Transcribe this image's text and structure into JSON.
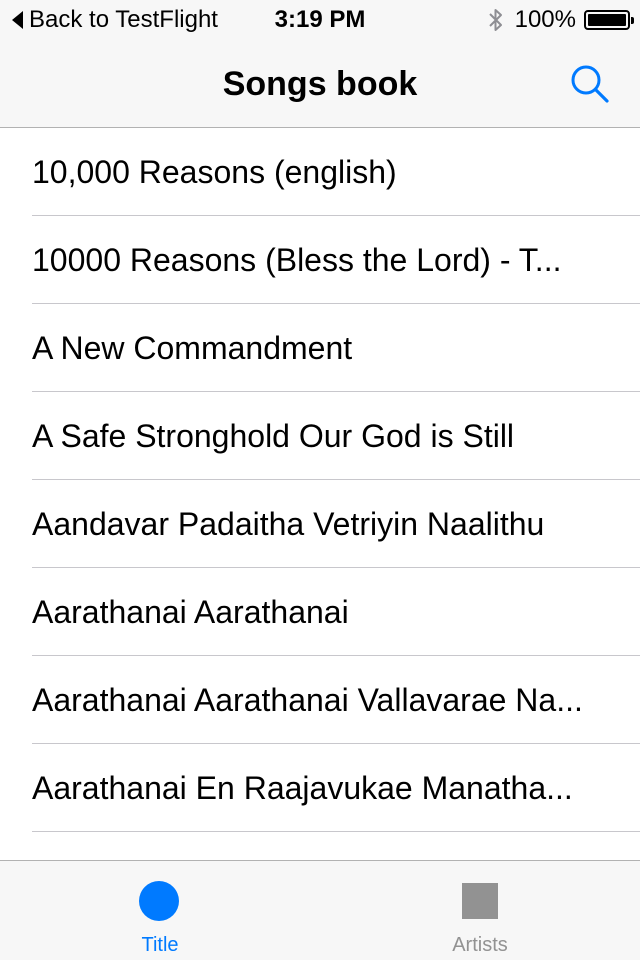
{
  "status_bar": {
    "back_label": "Back to TestFlight",
    "time": "3:19 PM",
    "battery_text": "100%",
    "battery_level": 1.0
  },
  "nav": {
    "title": "Songs book",
    "search_icon": "search-icon",
    "accent_color": "#007aff"
  },
  "songs": [
    {
      "title": "10,000 Reasons (english)"
    },
    {
      "title": "10000 Reasons (Bless the Lord) - T..."
    },
    {
      "title": "A New Commandment"
    },
    {
      "title": "A Safe Stronghold Our God is Still"
    },
    {
      "title": "Aandavar Padaitha Vetriyin Naalithu"
    },
    {
      "title": "Aarathanai Aarathanai"
    },
    {
      "title": "Aarathanai Aarathanai Vallavarae Na..."
    },
    {
      "title": "Aarathanai En Raajavukae Manatha..."
    }
  ],
  "tab_bar": {
    "tabs": [
      {
        "label": "Title",
        "icon": "circle-icon",
        "color": "#007aff",
        "selected": true
      },
      {
        "label": "Artists",
        "icon": "square-icon",
        "color": "#929292",
        "selected": false
      }
    ]
  }
}
